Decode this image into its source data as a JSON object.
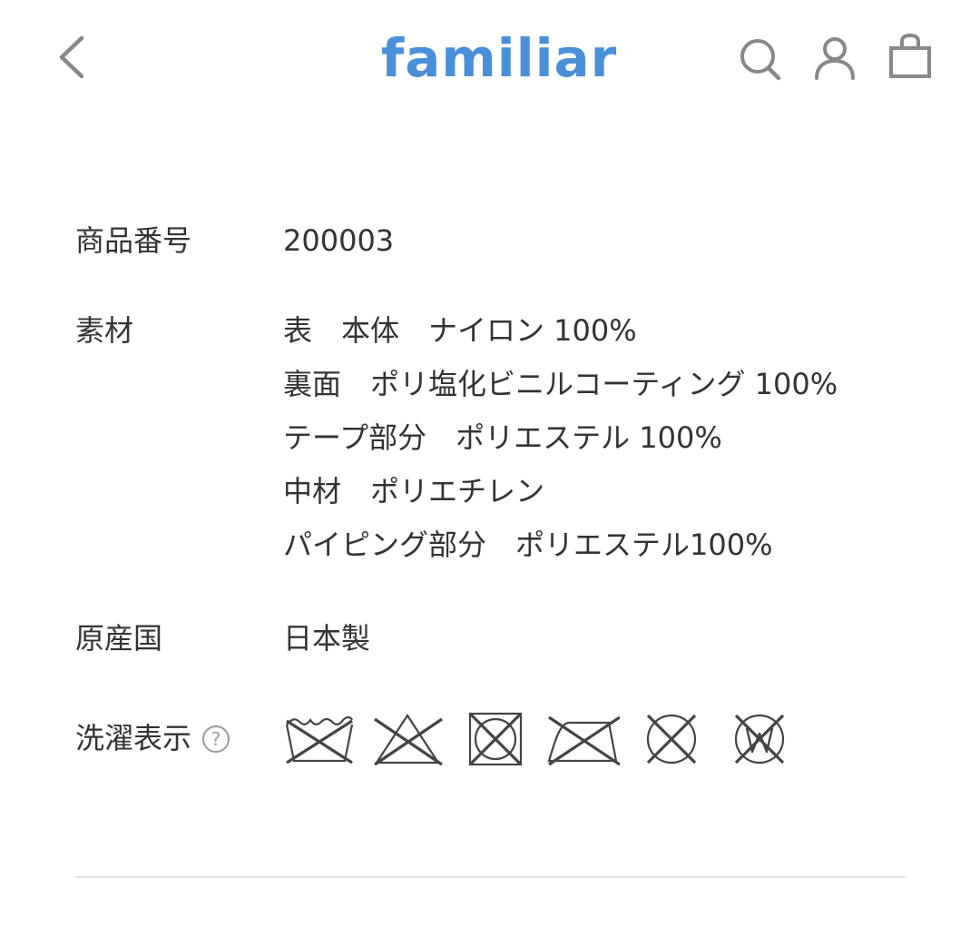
{
  "header": {
    "logo_text": "familiar",
    "brand_color": "#4a90d9",
    "icon_color": "#888888",
    "back_icon": "chevron-left-icon",
    "search_icon": "search-icon",
    "account_icon": "user-icon",
    "cart_icon": "shopping-bag-icon"
  },
  "specs": {
    "product_code": {
      "label": "商品番号",
      "value": "200003"
    },
    "material": {
      "label": "素材",
      "lines": [
        "表　本体　ナイロン 100%",
        "裏面　ポリ塩化ビニルコーティング 100%",
        "テープ部分　ポリエステル 100%",
        "中材　ポリエチレン",
        "パイピング部分　ポリエステル100%"
      ]
    },
    "origin": {
      "label": "原産国",
      "value": "日本製"
    },
    "care": {
      "label": "洗濯表示",
      "help_glyph": "?",
      "icons": [
        "no-washing-icon",
        "no-bleach-icon",
        "no-tumble-dry-icon",
        "no-ironing-icon",
        "no-dry-cleaning-icon",
        "no-wet-cleaning-icon"
      ]
    }
  }
}
